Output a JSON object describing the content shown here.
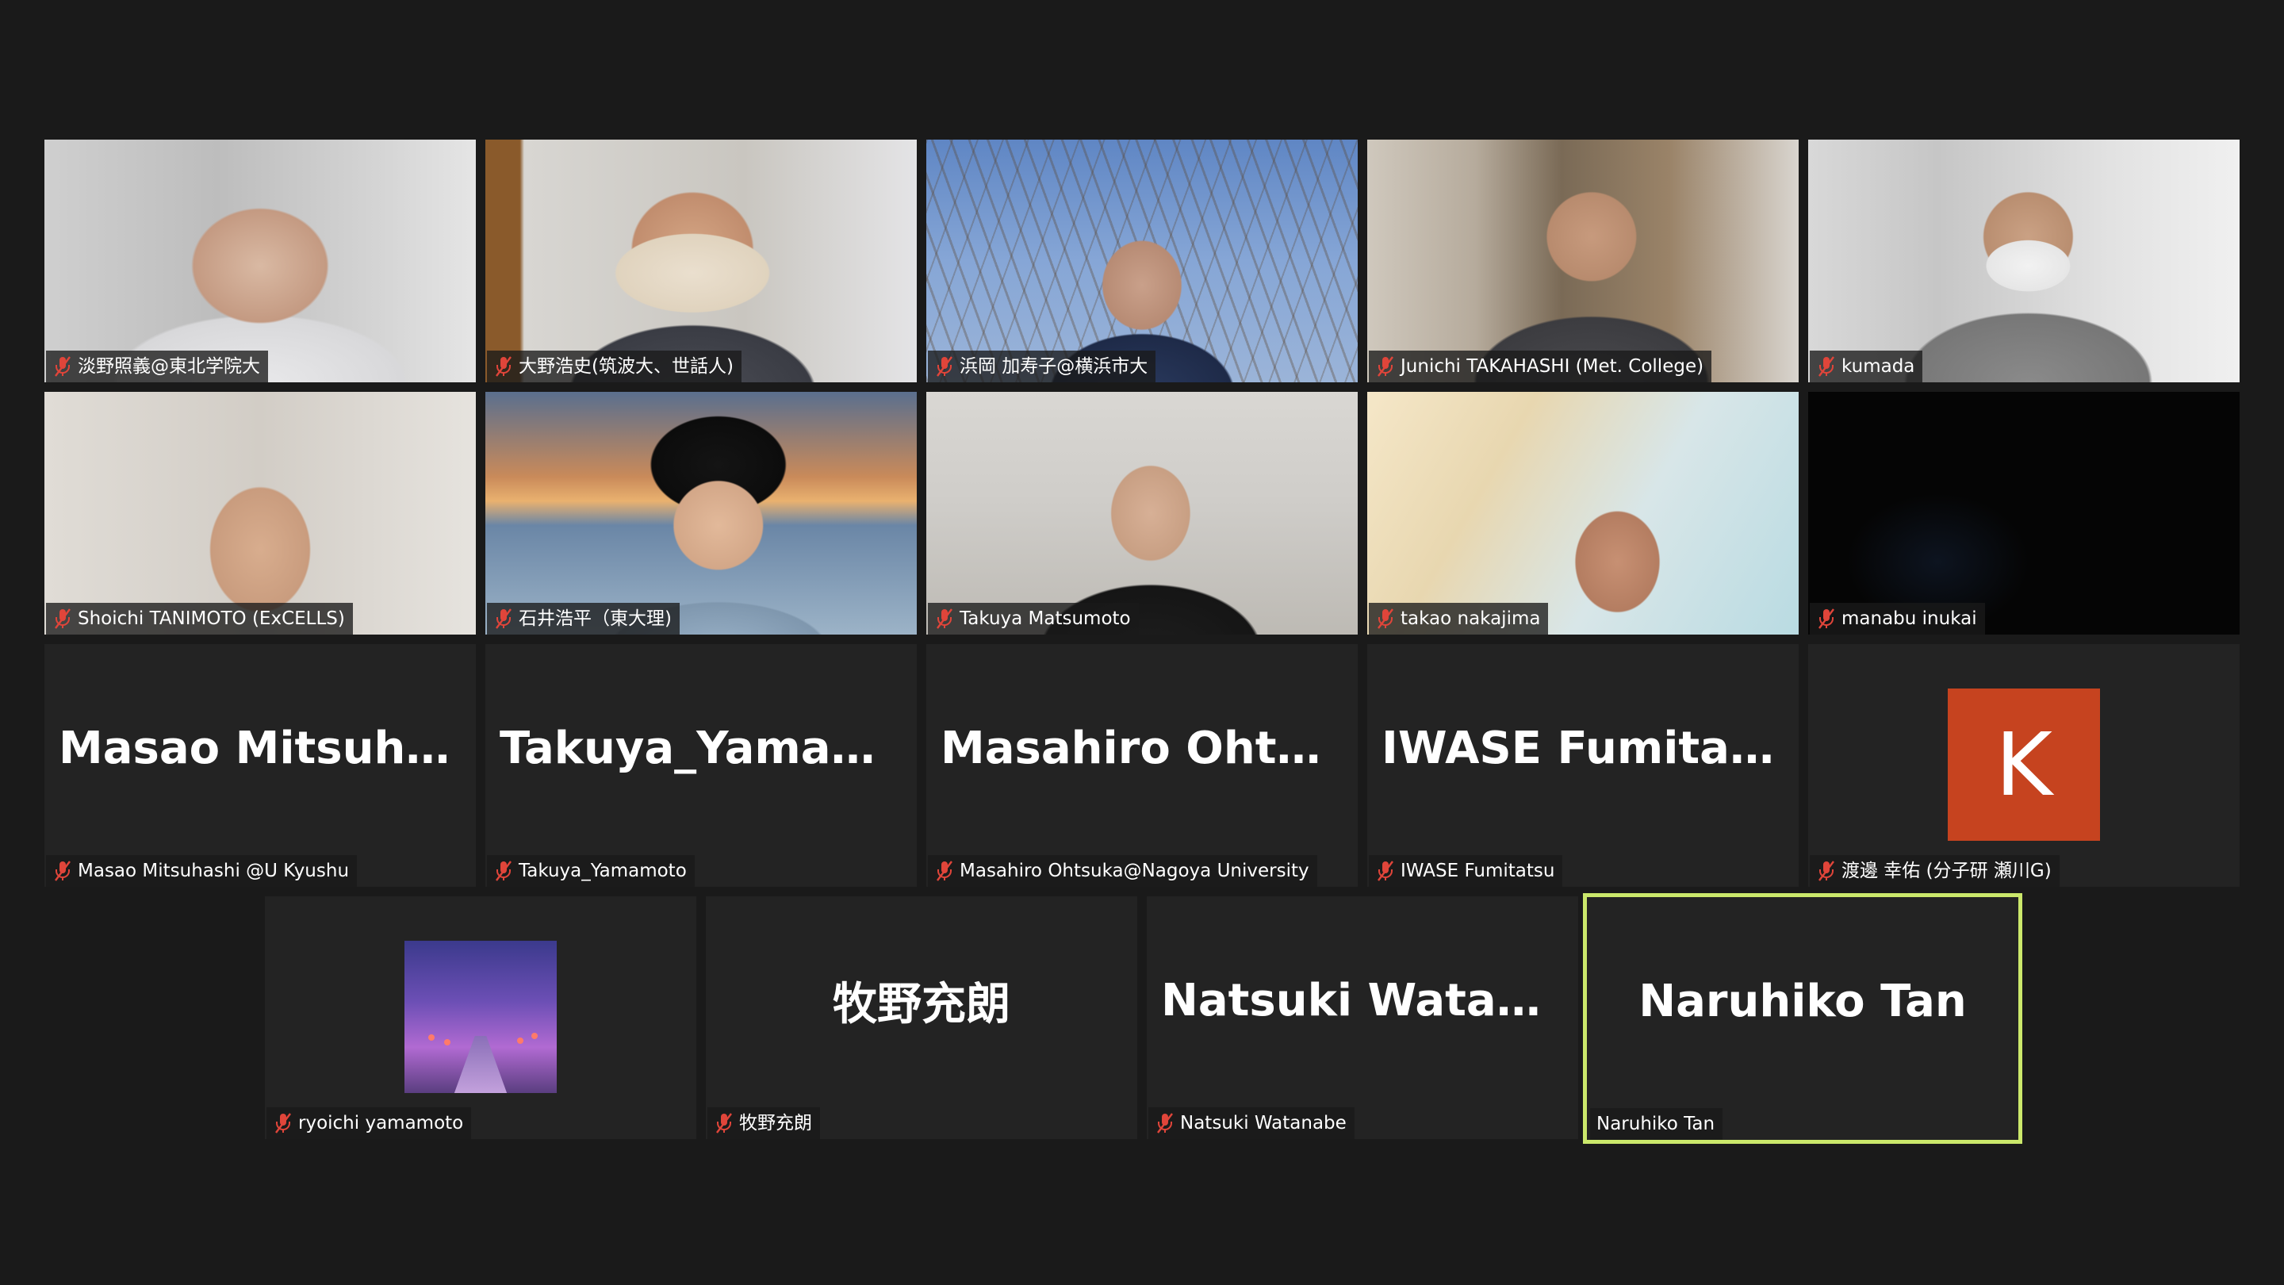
{
  "colors": {
    "background": "#1a1a1a",
    "tile": "#232323",
    "speaking_border": "#cbe86b",
    "muted_icon": "#e0453a",
    "avatar_k_bg": "#c6431f"
  },
  "participants": [
    {
      "name": "淡野照義@東北学院大",
      "muted": true,
      "video": "on"
    },
    {
      "name": "大野浩史(筑波大、世話人)",
      "muted": true,
      "video": "on"
    },
    {
      "name": "浜岡 加寿子@横浜市大",
      "muted": true,
      "video": "on"
    },
    {
      "name": "Junichi TAKAHASHI (Met. College)",
      "muted": true,
      "video": "on"
    },
    {
      "name": "kumada",
      "muted": true,
      "video": "on"
    },
    {
      "name": "Shoichi TANIMOTO (ExCELLS)",
      "muted": true,
      "video": "on"
    },
    {
      "name": "石井浩平（東大理)",
      "muted": true,
      "video": "on"
    },
    {
      "name": "Takuya Matsumoto",
      "muted": true,
      "video": "on"
    },
    {
      "name": "takao nakajima",
      "muted": true,
      "video": "on"
    },
    {
      "name": "manabu inukai",
      "muted": true,
      "video": "dark"
    },
    {
      "name": "Masao Mitsuhashi @U Kyushu",
      "muted": true,
      "video": "off",
      "display_name": "Masao  Mitsuhas..."
    },
    {
      "name": "Takuya_Yamamoto",
      "muted": true,
      "video": "off",
      "display_name": "Takuya_Yamamoto"
    },
    {
      "name": "Masahiro Ohtsuka@Nagoya University",
      "muted": true,
      "video": "off",
      "display_name": "Masahiro  Ohtsu..."
    },
    {
      "name": "IWASE Fumitatsu",
      "muted": true,
      "video": "off",
      "display_name": "IWASE Fumitatsu"
    },
    {
      "name": "渡邊 幸佑 (分子研 瀬川G)",
      "muted": true,
      "video": "off",
      "avatar_letter": "K"
    },
    {
      "name": "ryoichi yamamoto",
      "muted": true,
      "video": "off",
      "avatar": "cherry-blossom-photo"
    },
    {
      "name": "牧野充朗",
      "muted": true,
      "video": "off",
      "display_name": "牧野充朗"
    },
    {
      "name": "Natsuki Watanabe",
      "muted": true,
      "video": "off",
      "display_name": "Natsuki Watanabe"
    },
    {
      "name": "Naruhiko Tan",
      "muted": false,
      "video": "off",
      "display_name": "Naruhiko Tan",
      "speaking": true
    }
  ]
}
